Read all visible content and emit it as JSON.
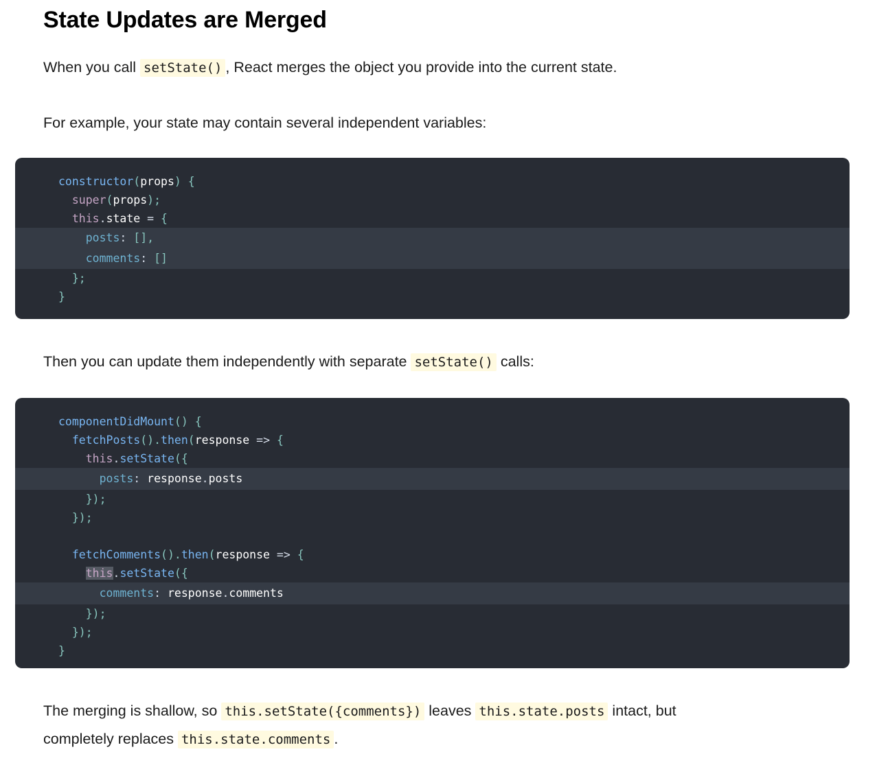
{
  "heading": "State Updates are Merged",
  "intro": {
    "before": "When you call ",
    "code": "setState()",
    "after": ", React merges the object you provide into the current state."
  },
  "example_text": "For example, your state may contain several independent variables:",
  "code_block_1": {
    "line1": {
      "fn": "constructor",
      "open": "(",
      "arg": "props",
      "close": ") {"
    },
    "line2": {
      "kw": "super",
      "open": "(",
      "arg": "props",
      "close": ");"
    },
    "line3": {
      "kw": "this",
      "dot": ".",
      "prop": "state",
      "eq": " = ",
      "brace": "{"
    },
    "line4": {
      "prop": "posts",
      "colon": ": ",
      "val": "[],"
    },
    "line5": {
      "prop": "comments",
      "colon": ": ",
      "val": "[]"
    },
    "line6": {
      "punc": "};"
    },
    "line7": {
      "punc": "}"
    }
  },
  "then_text": {
    "before": "Then you can update them independently with separate ",
    "code": "setState()",
    "after": " calls:"
  },
  "code_block_2": {
    "line1": {
      "fn": "componentDidMount",
      "rest": "() {"
    },
    "line2": {
      "fn": "fetchPosts",
      "p1": "().",
      "then": "then",
      "p2": "(",
      "arg": "response",
      "arrow": " => ",
      "brace": "{"
    },
    "line3": {
      "kw": "this",
      "dot": ".",
      "fn": "setState",
      "p": "({"
    },
    "line4": {
      "prop": "posts",
      "colon": ": ",
      "obj": "response",
      "dot": ".",
      "field": "posts"
    },
    "line5": {
      "punc": "});"
    },
    "line6": {
      "punc": "});"
    },
    "line8": {
      "fn": "fetchComments",
      "p1": "().",
      "then": "then",
      "p2": "(",
      "arg": "response",
      "arrow": " => ",
      "brace": "{"
    },
    "line9": {
      "kw": "this",
      "dot": ".",
      "fn": "setState",
      "p": "({"
    },
    "line10": {
      "prop": "comments",
      "colon": ": ",
      "obj": "response",
      "dot": ".",
      "field": "comments"
    },
    "line11": {
      "punc": "});"
    },
    "line12": {
      "punc": "});"
    },
    "line13": {
      "punc": "}"
    }
  },
  "closing": {
    "t1": "The merging is shallow, so ",
    "c1": "this.setState({comments})",
    "t2": " leaves ",
    "c2": "this.state.posts",
    "t3": " intact, but completely replaces ",
    "c3": "this.state.comments",
    "t4": "."
  }
}
